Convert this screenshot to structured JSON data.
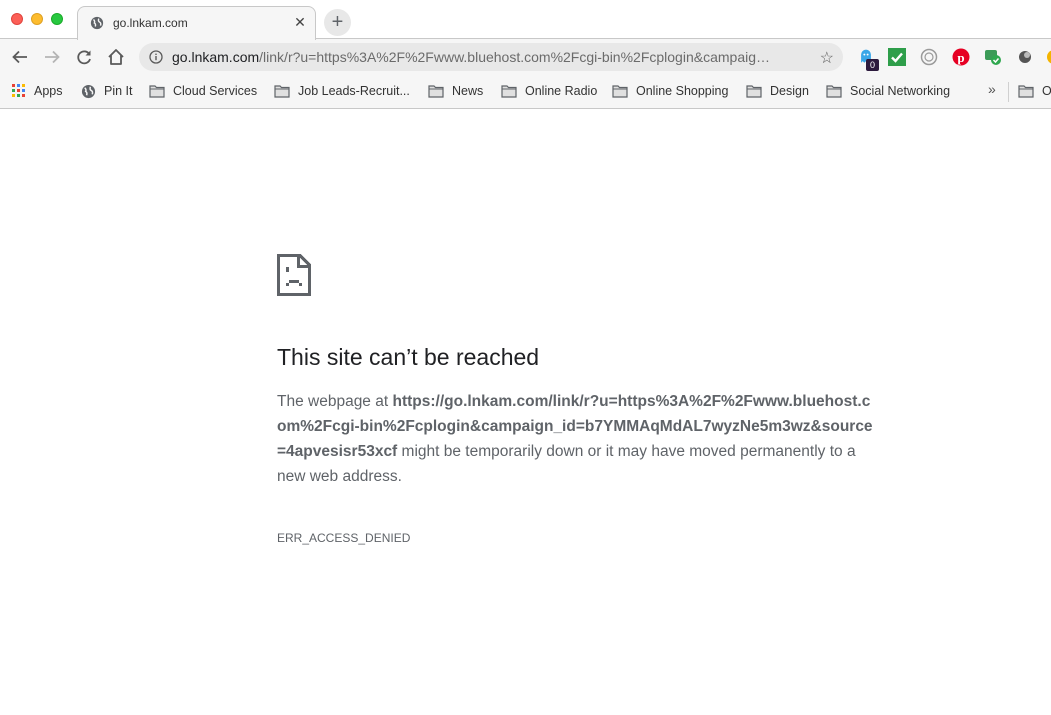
{
  "window": {
    "traffic_lights": [
      "close",
      "minimize",
      "zoom"
    ]
  },
  "tab": {
    "title": "go.lnkam.com",
    "favicon": "globe-icon",
    "close_glyph": "✕",
    "new_tab_glyph": "+"
  },
  "toolbar": {
    "back": "back-arrow-icon",
    "forward": "forward-arrow-icon",
    "reload": "reload-icon",
    "home": "home-icon",
    "url_host": "go.lnkam.com",
    "url_rest": "/link/r?u=https%3A%2F%2Fwww.bluehost.com%2Fcgi-bin%2Fcplogin&campaig…",
    "star_glyph": "☆",
    "extensions": [
      {
        "name": "ghostery-extension",
        "badge": "0",
        "color": "#3aa7e8"
      },
      {
        "name": "checkmark-extension",
        "color": "#2e9e4a"
      },
      {
        "name": "circle-extension",
        "color": "#9a9a9a"
      },
      {
        "name": "pinterest-extension",
        "color": "#e60023"
      },
      {
        "name": "grammar-extension",
        "color": "#3b9b57"
      },
      {
        "name": "orb-extension",
        "color": "#555555"
      }
    ]
  },
  "bookmarks": {
    "items": [
      {
        "label": "Apps",
        "icon": "apps-grid-icon"
      },
      {
        "label": "Pin It",
        "icon": "globe-icon"
      },
      {
        "label": "Cloud Services",
        "icon": "folder-icon"
      },
      {
        "label": "Job Leads-Recruit...",
        "icon": "folder-icon"
      },
      {
        "label": "News",
        "icon": "folder-icon"
      },
      {
        "label": "Online Radio",
        "icon": "folder-icon"
      },
      {
        "label": "Online Shopping",
        "icon": "folder-icon"
      },
      {
        "label": "Design",
        "icon": "folder-icon"
      },
      {
        "label": "Social Networking",
        "icon": "folder-icon"
      }
    ],
    "overflow_glyph": "»",
    "other_label": "O"
  },
  "error_page": {
    "heading": "This site can’t be reached",
    "desc_prefix": "The webpage at ",
    "desc_url": "https://go.lnkam.com/link/r?u=https%3A%2F%2Fwww.bluehost.com%2Fcgi-bin%2Fcplogin&campaign_id=b7YMMAqMdAL7wyzNe5m3wz&source=4apvesisr53xcf",
    "desc_suffix": " might be temporarily down or it may have moved permanently to a new web address.",
    "error_code": "ERR_ACCESS_DENIED"
  }
}
